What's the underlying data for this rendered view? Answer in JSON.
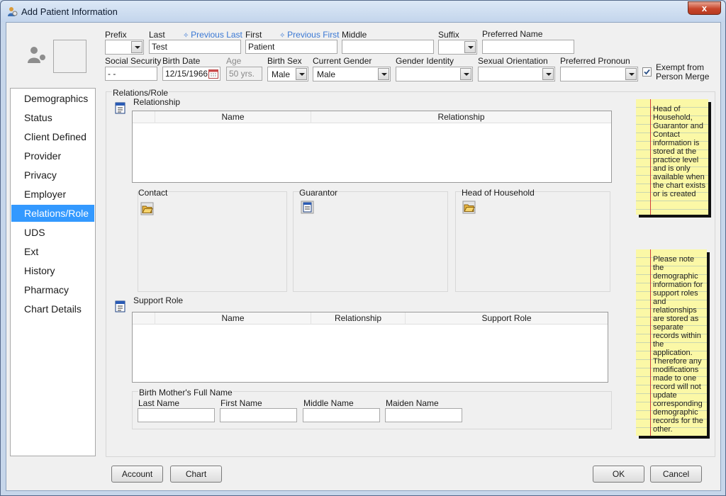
{
  "window": {
    "title": "Add Patient Information",
    "close_label": "x"
  },
  "name_fields": {
    "prefix_label": "Prefix",
    "prefix_value": "",
    "last_label": "Last",
    "previous_last_link": "Previous Last",
    "last_value": "Test",
    "first_label": "First",
    "previous_first_link": "Previous First",
    "first_value": "Patient",
    "middle_label": "Middle",
    "middle_value": "",
    "suffix_label": "Suffix",
    "suffix_value": "",
    "preferred_name_label": "Preferred Name",
    "preferred_name_value": ""
  },
  "demo_fields": {
    "ssn_label": "Social Security",
    "ssn_value": " -  -",
    "birth_date_label": "Birth Date",
    "birth_date_value": "12/15/1966",
    "age_label": "Age",
    "age_value": "50 yrs.",
    "birth_sex_label": "Birth Sex",
    "birth_sex_value": "Male",
    "current_gender_label": "Current Gender",
    "current_gender_value": "Male",
    "gender_identity_label": "Gender Identity",
    "gender_identity_value": "",
    "sexual_orientation_label": "Sexual Orientation",
    "sexual_orientation_value": "",
    "preferred_pronoun_label": "Preferred Pronoun",
    "preferred_pronoun_value": "",
    "exempt_label_line1": "Exempt from",
    "exempt_label_line2": "Person Merge",
    "exempt_checked": true
  },
  "sidebar": {
    "items": [
      {
        "label": "Demographics"
      },
      {
        "label": "Status"
      },
      {
        "label": "Client Defined"
      },
      {
        "label": "Provider"
      },
      {
        "label": "Privacy"
      },
      {
        "label": "Employer"
      },
      {
        "label": "Relations/Role"
      },
      {
        "label": "UDS"
      },
      {
        "label": "Ext"
      },
      {
        "label": "History"
      },
      {
        "label": "Pharmacy"
      },
      {
        "label": "Chart Details"
      }
    ],
    "active_label": "Relations/Role"
  },
  "relations": {
    "section_title": "Relations/Role",
    "relationship_title": "Relationship",
    "relationship_columns": [
      "Name",
      "Relationship"
    ],
    "contact_label": "Contact",
    "guarantor_label": "Guarantor",
    "head_of_household_label": "Head of Household",
    "support_role_title": "Support Role",
    "support_columns": [
      "Name",
      "Relationship",
      "Support Role"
    ],
    "birth_mother_title": "Birth Mother's Full Name",
    "bm_last_label": "Last Name",
    "bm_first_label": "First Name",
    "bm_middle_label": "Middle Name",
    "bm_maiden_label": "Maiden Name"
  },
  "notes": {
    "note1": [
      "Head of",
      "Household,",
      "Guarantor and",
      "Contact",
      "information is",
      "stored at the",
      "practice level",
      "and is only",
      "available when",
      "the chart exists",
      "or is created"
    ],
    "note2": [
      "Please note",
      "the",
      "demographic",
      "information for",
      "support roles",
      "and",
      "relationships",
      "are stored as",
      "separate",
      "records within",
      "the application.",
      "Therefore any",
      "modifications",
      "made to one",
      "record will not",
      "update",
      "corresponding",
      "demographic",
      "records for the",
      "other."
    ]
  },
  "footer": {
    "account": "Account",
    "chart": "Chart",
    "ok": "OK",
    "cancel": "Cancel"
  },
  "colors": {
    "active_nav": "#3399ff",
    "link": "#3a78d4",
    "note_bg": "#fbf8a6"
  }
}
